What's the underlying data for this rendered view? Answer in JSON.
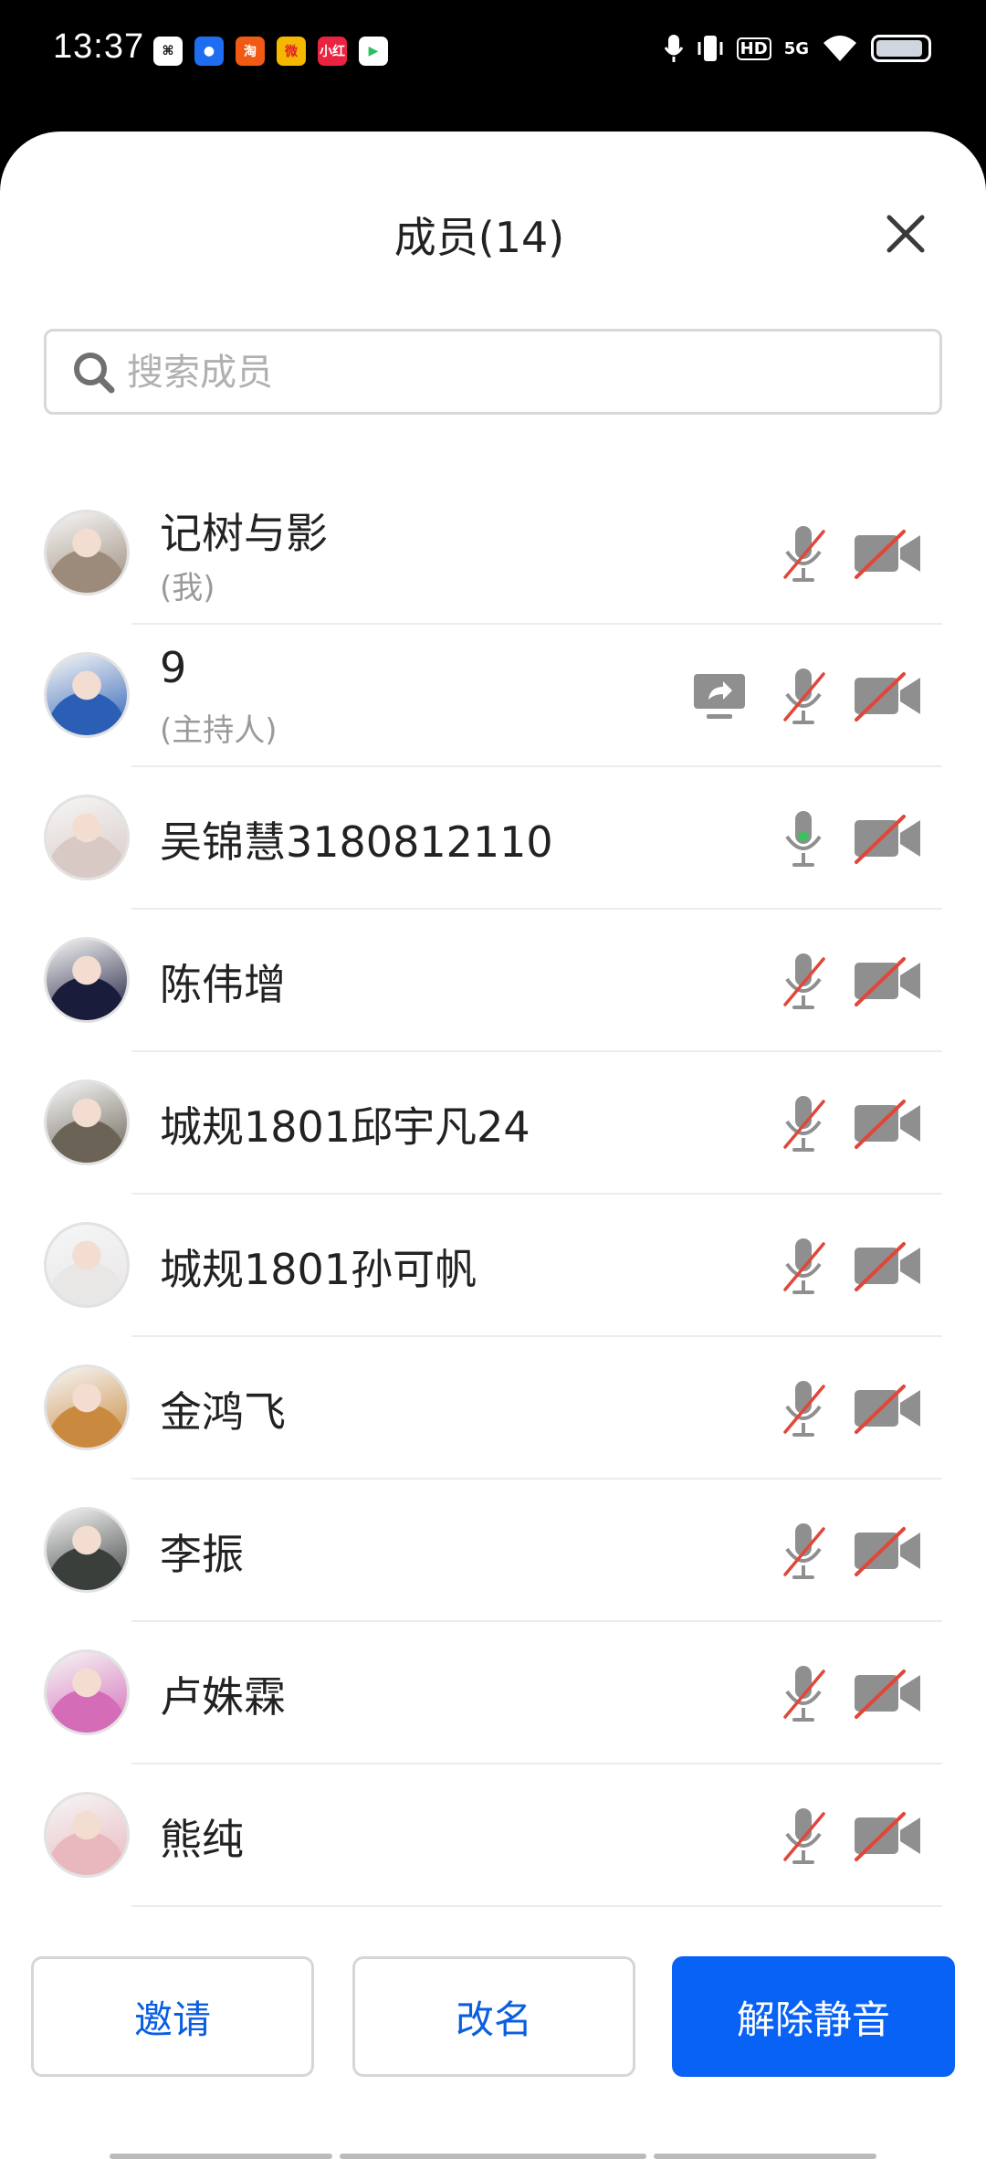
{
  "status_bar": {
    "time": "13:37",
    "app_icons": [
      {
        "name": "app-icon-1",
        "color": "#ffffff",
        "glyph": "⌘",
        "fg": "#000"
      },
      {
        "name": "app-icon-2",
        "color": "#1e6cf0",
        "glyph": "●",
        "fg": "#fff"
      },
      {
        "name": "app-icon-taobao",
        "color": "#f05a14",
        "glyph": "淘",
        "fg": "#fff"
      },
      {
        "name": "app-icon-weibo",
        "color": "#f5b800",
        "glyph": "微",
        "fg": "#e0202a"
      },
      {
        "name": "app-icon-xiaohongshu",
        "color": "#ea2340",
        "glyph": "小红",
        "fg": "#fff"
      },
      {
        "name": "app-icon-video",
        "color": "#ffffff",
        "glyph": "▶",
        "fg": "#28c060"
      }
    ],
    "signal_text": "5G",
    "hd_text": "HD"
  },
  "panel": {
    "title": "成员(14)",
    "search_placeholder": "搜索成员"
  },
  "members": [
    {
      "name": "记树与影",
      "role": "(我)",
      "mic_on": false,
      "cam_on": false,
      "sharing": false,
      "avatar_color": "#9c8a7a"
    },
    {
      "name": "9",
      "role": "(主持人)",
      "mic_on": false,
      "cam_on": false,
      "sharing": true,
      "avatar_color": "#2a5fb5"
    },
    {
      "name": "吴锦慧3180812110",
      "role": "",
      "mic_on": true,
      "cam_on": false,
      "sharing": false,
      "avatar_color": "#d8c9c4"
    },
    {
      "name": "陈伟增",
      "role": "",
      "mic_on": false,
      "cam_on": false,
      "sharing": false,
      "avatar_color": "#1a1c3c"
    },
    {
      "name": "城规1801邱宇凡24",
      "role": "",
      "mic_on": false,
      "cam_on": false,
      "sharing": false,
      "avatar_color": "#6b6456"
    },
    {
      "name": "城规1801孙可帆",
      "role": "",
      "mic_on": false,
      "cam_on": false,
      "sharing": false,
      "avatar_color": "#e9e6e6"
    },
    {
      "name": "金鸿飞",
      "role": "",
      "mic_on": false,
      "cam_on": false,
      "sharing": false,
      "avatar_color": "#c98a3f"
    },
    {
      "name": "李振",
      "role": "",
      "mic_on": false,
      "cam_on": false,
      "sharing": false,
      "avatar_color": "#3a3f3c"
    },
    {
      "name": "卢姝霖",
      "role": "",
      "mic_on": false,
      "cam_on": false,
      "sharing": false,
      "avatar_color": "#d46cb8"
    },
    {
      "name": "熊纯",
      "role": "",
      "mic_on": false,
      "cam_on": false,
      "sharing": false,
      "avatar_color": "#e8b8be"
    }
  ],
  "buttons": {
    "invite": "邀请",
    "rename": "改名",
    "unmute": "解除静音"
  },
  "colors": {
    "accent": "#0862f6",
    "muted_slash": "#e0473a",
    "mic_active": "#3fbf5f",
    "icon_gray": "#8f8f8f"
  }
}
